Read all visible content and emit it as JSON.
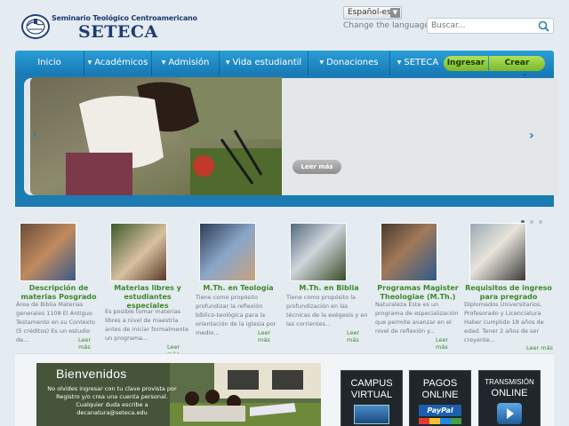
{
  "header": {
    "logo": {
      "subtitle": "Seminario Teológico Centroamericano",
      "name": "SETECA"
    },
    "language_select": {
      "value": "Español-es"
    },
    "change_language": "Change the language",
    "search": {
      "placeholder": "Buscar..."
    }
  },
  "nav": {
    "items": [
      {
        "label": "Inicio",
        "dropdown": false
      },
      {
        "label": "Académicos",
        "dropdown": true
      },
      {
        "label": "Admisión",
        "dropdown": true
      },
      {
        "label": "Vida estudiantil",
        "dropdown": true
      },
      {
        "label": "Donaciones",
        "dropdown": true
      },
      {
        "label": "SETECA",
        "dropdown": true
      }
    ],
    "login_label": "Ingresar",
    "signup_label": "Crear cuenta"
  },
  "slider": {
    "read_more": "Leer más",
    "prev_icon": "chevron-left-icon",
    "next_icon": "chevron-right-icon",
    "dot_count": 3,
    "active_dot": 0
  },
  "programs": [
    {
      "title": "Descripción de materias Posgrado",
      "text": "Área de Biblia Materias generales 1108 El Antiguo Testamento en su Contexto (5 créditos) Es un estudio de...",
      "more": "Leer más"
    },
    {
      "title": "Materias libres y estudiantes especiales",
      "text": "Es posible tomar materias libres a nivel de maestría antes de iniciar formalmente un programa...",
      "more": "Leer más"
    },
    {
      "title": "M.Th. en Teología",
      "text": "Tiene como propósito profundizar la reflexión bíblico-teológica para la orientación de la iglesia por medio...",
      "more": "Leer más"
    },
    {
      "title": "M.Th. en Biblia",
      "text": "Tiene como propósito la profundización en las técnicas de la exégesis y en las corrientes...",
      "more": "Leer más"
    },
    {
      "title": "Programas Magister Theologiae (M.Th.)",
      "text": "Naturaleza Este es un programa de especialización que permite avanzar en el nivel de reflexión y...",
      "more": "Leer más"
    },
    {
      "title": "Requisitos de ingreso para pregrado",
      "text": "Diplomados Universitarios, Profesorado y Licenciatura Haber cumplido 18 años de edad. Tener 2 años de ser creyente...",
      "more": "Leer más"
    }
  ],
  "welcome": {
    "title": "Bienvenidos",
    "text": "No olvides ingresar con tu clave provista por Registro y/o crea una cuenta personal. Cualquier duda escribe a decanatura@seteca.edu"
  },
  "promos": [
    {
      "line1": "CAMPUS",
      "line2": "VIRTUAL"
    },
    {
      "line1": "PAGOS",
      "line2": "ONLINE",
      "line3": "PayPal"
    },
    {
      "line1": "TRANSMISIÓN",
      "line2": "ONLINE"
    }
  ],
  "colors": {
    "nav_blue": "#1f8bc7",
    "accent_green": "#8cc63f",
    "title_green": "#3d8a2a",
    "brand_navy": "#213b72"
  }
}
